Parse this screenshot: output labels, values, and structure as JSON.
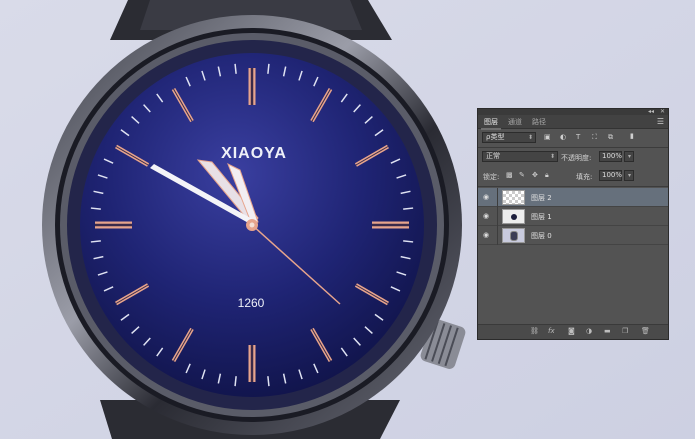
{
  "photo": {
    "brand": "XIAOYA",
    "model": "1260"
  },
  "panel": {
    "collapse_glyph": "◂◂",
    "close_glyph": "✕",
    "menu_glyph": "☰",
    "tabs": [
      "图层",
      "通道",
      "路径"
    ],
    "active_tab": 0,
    "filter": {
      "kind_label": "ρ类型",
      "icons": [
        "image-filter-icon",
        "adjustment-filter-icon",
        "type-filter-icon",
        "shape-filter-icon",
        "smart-object-filter-icon",
        "filter-toggle-icon"
      ]
    },
    "blend_mode": "正常",
    "opacity_label": "不透明度:",
    "opacity_value": "100%",
    "lock_label": "锁定:",
    "lock_icons": [
      "lock-transparent-icon",
      "lock-paint-icon",
      "lock-position-icon",
      "lock-all-icon"
    ],
    "fill_label": "填充:",
    "fill_value": "100%",
    "layers": [
      {
        "name": "图层 2",
        "selected": true,
        "thumb": "transparent"
      },
      {
        "name": "图层 1",
        "selected": false,
        "thumb": "dot"
      },
      {
        "name": "图层 0",
        "selected": false,
        "thumb": "watch"
      }
    ],
    "bottom_icons": [
      "link-layers-icon",
      "fx-icon",
      "add-mask-icon",
      "adjustment-layer-icon",
      "new-group-icon",
      "new-layer-icon",
      "delete-layer-icon"
    ]
  },
  "colors": {
    "dial": "#1d2270",
    "rose_gold": "#e7a48c",
    "panel_bg": "#535353",
    "selected_layer": "#66707c"
  }
}
